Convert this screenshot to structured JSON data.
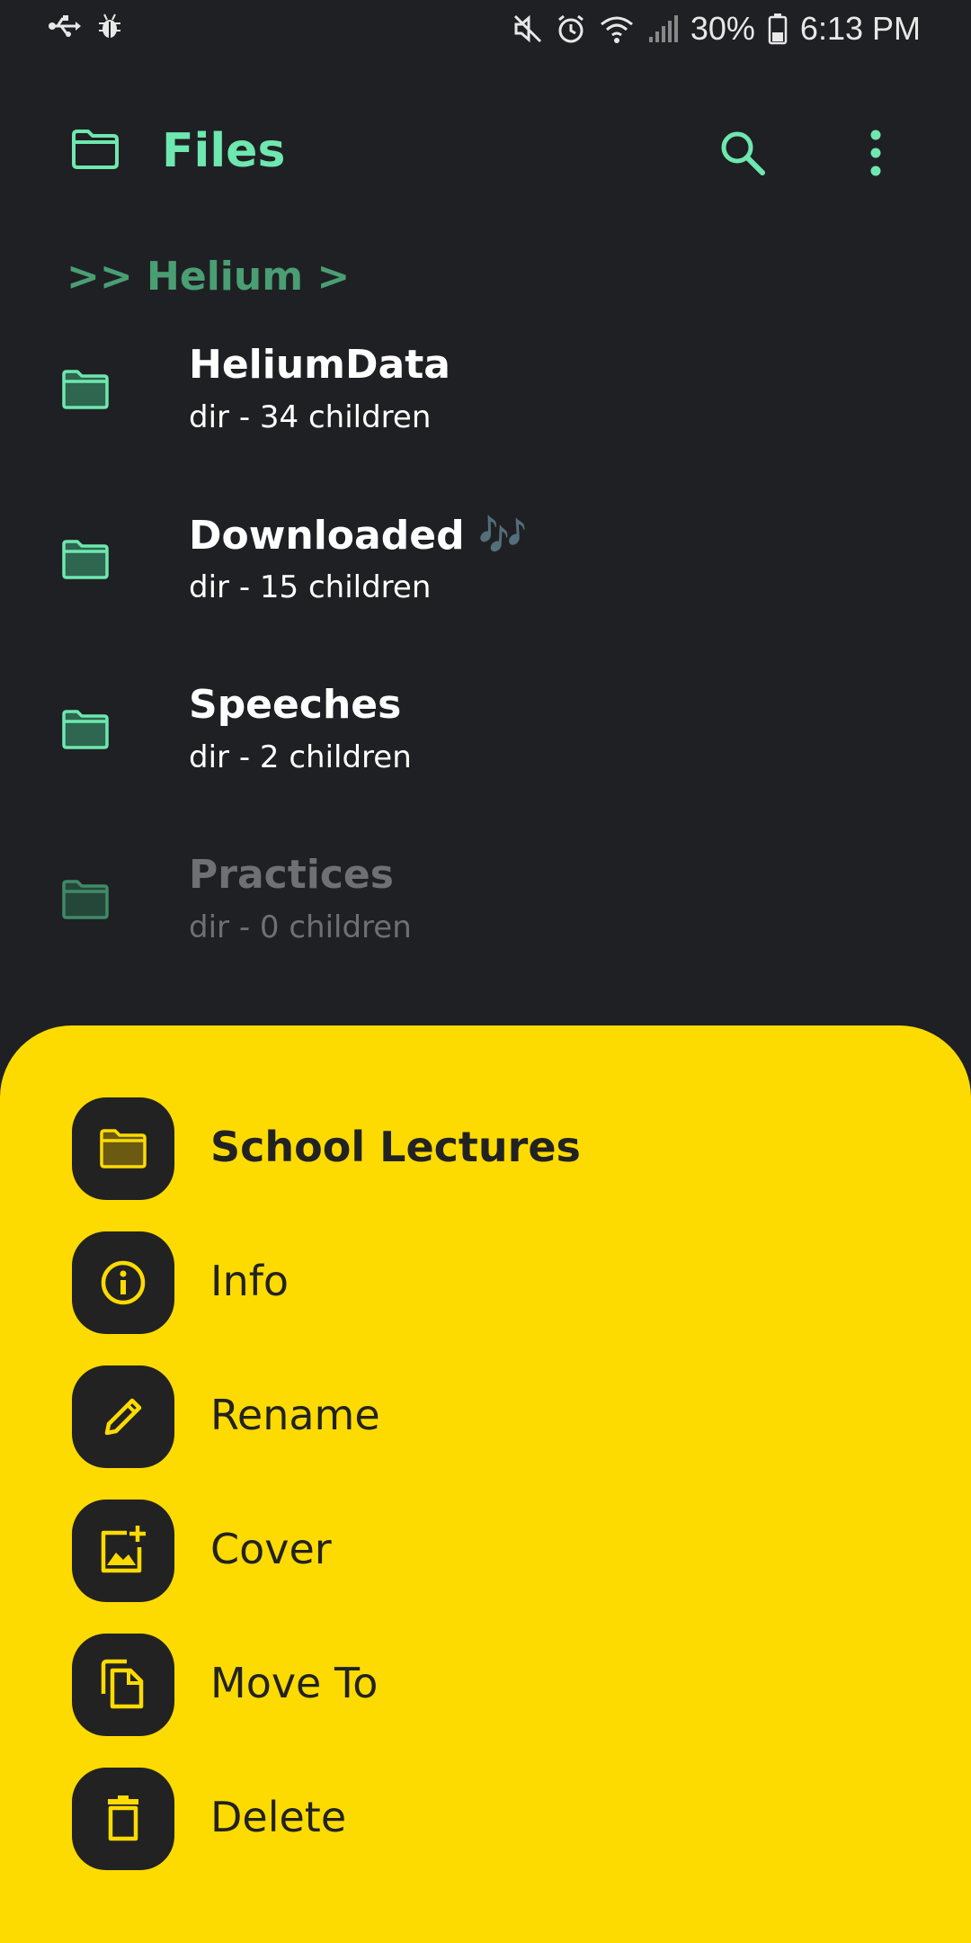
{
  "status_bar": {
    "battery": "30%",
    "time": "6:13 PM",
    "icons": [
      "usb-icon",
      "bug-icon",
      "mute-icon",
      "alarm-icon",
      "wifi-icon",
      "signal-icon",
      "battery-icon"
    ]
  },
  "app_bar": {
    "title": "Files",
    "icons": [
      "folder-icon",
      "search-icon",
      "more-vert-icon"
    ]
  },
  "breadcrumb": ">> Helium >",
  "files": [
    {
      "name": "HeliumData",
      "meta": "dir - 34 children"
    },
    {
      "name": "Downloaded 🎶",
      "meta": "dir - 15 children"
    },
    {
      "name": "Speeches",
      "meta": "dir - 2 children"
    },
    {
      "name": "Practices",
      "meta": "dir - 0 children"
    }
  ],
  "sheet": {
    "title": "School Lectures",
    "actions": [
      {
        "label": "Info",
        "icon": "info-icon"
      },
      {
        "label": "Rename",
        "icon": "pencil-icon"
      },
      {
        "label": "Cover",
        "icon": "add-photo-icon"
      },
      {
        "label": "Move To",
        "icon": "copy-file-icon"
      },
      {
        "label": "Delete",
        "icon": "trash-icon"
      }
    ]
  },
  "colors": {
    "background": "#1f2023",
    "accent": "#6ee8b0",
    "breadcrumb": "#4a9e74",
    "sheet": "#fedb00",
    "sheet_icon_bg": "#222222"
  }
}
